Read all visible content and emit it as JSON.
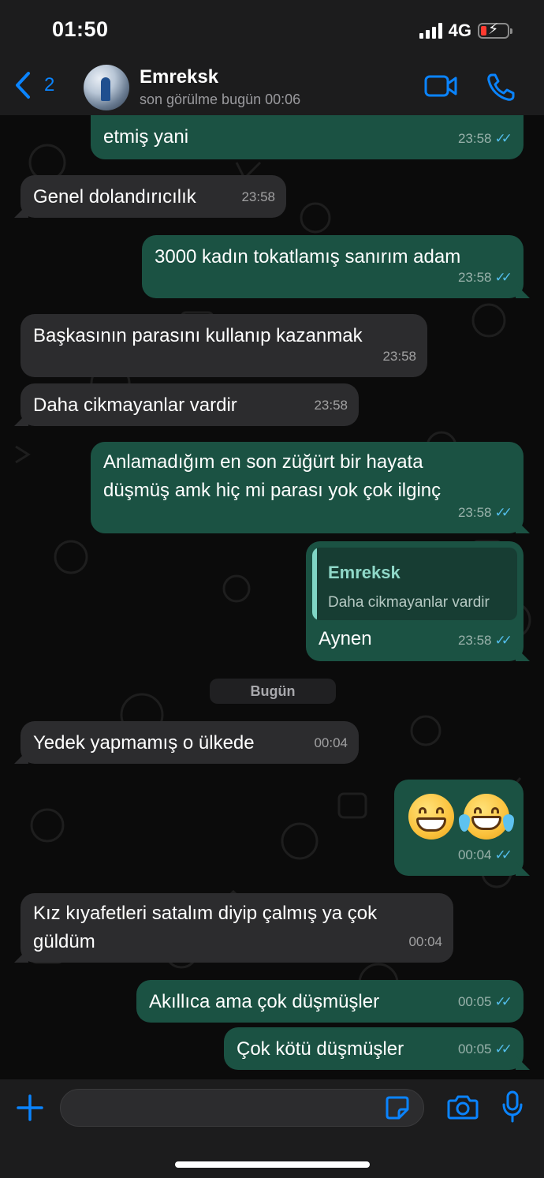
{
  "status_bar": {
    "time": "01:50",
    "network": "4G",
    "battery": "low, charging"
  },
  "header": {
    "back_count": "2",
    "contact_name": "Emreksk",
    "last_seen": "son görülme bugün 00:06",
    "accent_color": "#0a84ff"
  },
  "chat": {
    "date_separator": "Bugün",
    "messages": [
      {
        "direction": "out",
        "text": "etmiş yani",
        "time": "23:58",
        "read": true
      },
      {
        "direction": "in",
        "text": "Genel dolandırıcılık",
        "time": "23:58"
      },
      {
        "direction": "out",
        "text": "3000 kadın tokatlamış sanırım adam",
        "time": "23:58",
        "read": true
      },
      {
        "direction": "in",
        "text": "Başkasının parasını kullanıp kazanmak",
        "time": "23:58"
      },
      {
        "direction": "in",
        "text": "Daha cikmayanlar vardir",
        "time": "23:58"
      },
      {
        "direction": "out",
        "text_lines": [
          "Anlamadığım en son züğürt bir hayata",
          "düşmüş amk hiç mi parası yok çok ilginç"
        ],
        "time": "23:58",
        "read": true
      },
      {
        "direction": "out",
        "quote_author": "Emreksk",
        "quote_text": "Daha cikmayanlar vardir",
        "text": "Aynen",
        "time": "23:58",
        "read": true
      },
      {
        "direction": "in",
        "text": "Yedek yapmamış o ülkede",
        "time": "00:04"
      },
      {
        "direction": "out",
        "emojis": [
          "grinning-face",
          "face-with-tears-of-joy"
        ],
        "time": "00:04",
        "read": true
      },
      {
        "direction": "in",
        "text_lines": [
          "Kız kıyafetleri satalım diyip çalmış ya çok",
          "güldüm"
        ],
        "time": "00:04"
      },
      {
        "direction": "out",
        "text": "Akıllıca ama çok düşmüşler",
        "time": "00:05",
        "read": true
      },
      {
        "direction": "out",
        "text": "Çok kötü düşmüşler",
        "time": "00:05",
        "read": true
      }
    ]
  },
  "input_bar": {
    "placeholder": ""
  },
  "colors": {
    "outgoing_bubble": "#1b5243",
    "incoming_bubble": "#2c2c2e",
    "read_ticks": "#53bdeb",
    "background": "#0b0b0b"
  }
}
